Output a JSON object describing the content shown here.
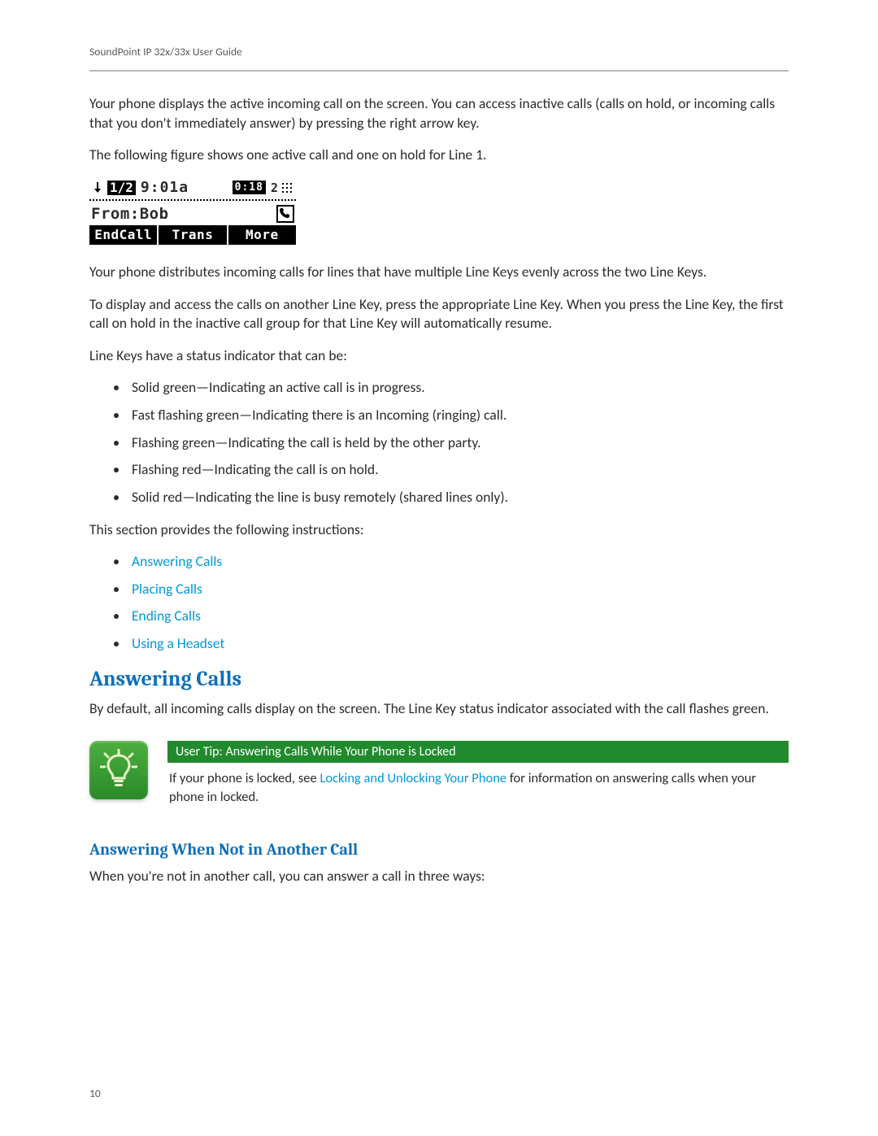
{
  "header": {
    "running_head": "SoundPoint IP 32x/33x User Guide"
  },
  "body": {
    "p1": "Your phone displays the active incoming call on the screen. You can access inactive calls (calls on hold, or incoming calls that you don't immediately answer) by pressing the right arrow key.",
    "p2": "The following figure shows one active call and one on hold for Line 1.",
    "p3": "Your phone distributes incoming calls for lines that have multiple Line Keys evenly across the two Line Keys.",
    "p4": "To display and access the calls on another Line Key, press the appropriate Line Key. When you press the Line Key, the first call on hold in the inactive call group for that Line Key will automatically resume.",
    "p5": "Line Keys have a status indicator that can be:",
    "status_items": [
      "Solid green—Indicating an active call is in progress.",
      "Fast flashing green—Indicating there is an Incoming (ringing) call.",
      "Flashing green—Indicating the call is held by the other party.",
      "Flashing red—Indicating the call is on hold.",
      "Solid red—Indicating the line is busy remotely (shared lines only)."
    ],
    "p6": "This section provides the following instructions:",
    "toc_links": [
      "Answering Calls",
      "Placing Calls",
      "Ending Calls",
      "Using a Headset"
    ],
    "h2_answering": "Answering Calls",
    "p7": "By default, all incoming calls display on the screen. The Line Key status indicator associated with the call flashes green.",
    "tip": {
      "title": "User Tip: Answering Calls While Your Phone is Locked",
      "pre": "If your phone is locked, see ",
      "link": "Locking and Unlocking Your Phone",
      "post": " for information on answering calls when your phone in locked."
    },
    "h3_not_in_call": "Answering When Not in Another Call",
    "p8": "When you're not in another call, you can answer a call in three ways:"
  },
  "lcd": {
    "call_index": "1/2",
    "time": "9:01a",
    "duration": "0:18",
    "count": "2",
    "from_label": "From:Bob",
    "softkeys": [
      "EndCall",
      "Trans",
      "More"
    ]
  },
  "footer": {
    "page_number": "10"
  }
}
